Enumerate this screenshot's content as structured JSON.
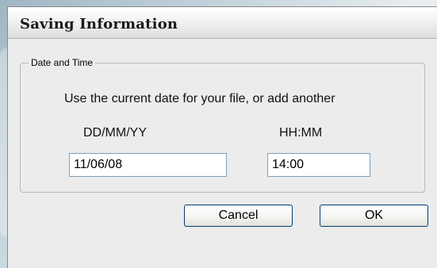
{
  "dialog": {
    "title": "Saving Information"
  },
  "group": {
    "legend": "Date and Time",
    "instruction": "Use the current date for your file, or add another"
  },
  "date": {
    "label": "DD/MM/YY",
    "value": "11/06/08"
  },
  "time": {
    "label": "HH:MM",
    "value": "14:00"
  },
  "buttons": {
    "cancel": "Cancel",
    "ok": "OK"
  }
}
